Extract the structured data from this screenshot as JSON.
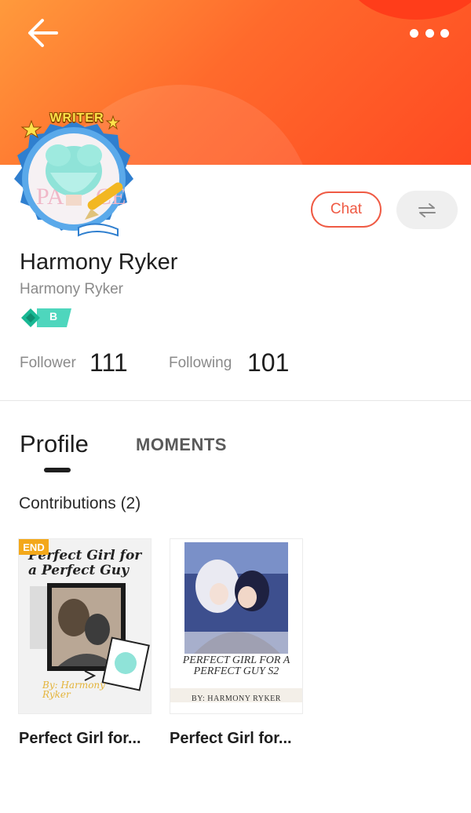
{
  "header": {
    "back_icon": "arrow-left-icon",
    "more_icon": "more-dots-icon"
  },
  "profile": {
    "badge_text": "WRITER",
    "name": "Harmony Ryker",
    "username": "Harmony Ryker",
    "level_letter": "B"
  },
  "actions": {
    "chat_label": "Chat",
    "swap_icon": "swap-arrows-icon"
  },
  "stats": {
    "follower_label": "Follower",
    "follower_count": "111",
    "following_label": "Following",
    "following_count": "101"
  },
  "tabs": [
    {
      "label": "Profile",
      "active": true
    },
    {
      "label": "MOMENTS",
      "active": false
    }
  ],
  "contributions": {
    "title": "Contributions (2)",
    "items": [
      {
        "tag": "END",
        "cover_title": "Perfect Girl for a Perfect Guy",
        "cover_author": "By: Harmony Ryker",
        "caption": "Perfect Girl for..."
      },
      {
        "cover_title": "PERFECT GIRL FOR A PERFECT GUY S2",
        "cover_author": "BY: HARMONY RYKER",
        "caption": "Perfect Girl for..."
      }
    ]
  },
  "colors": {
    "header_start": "#ff9a3c",
    "header_end": "#ff4a22",
    "accent": "#ef5a44",
    "level_badge": "#3fd1b0"
  }
}
